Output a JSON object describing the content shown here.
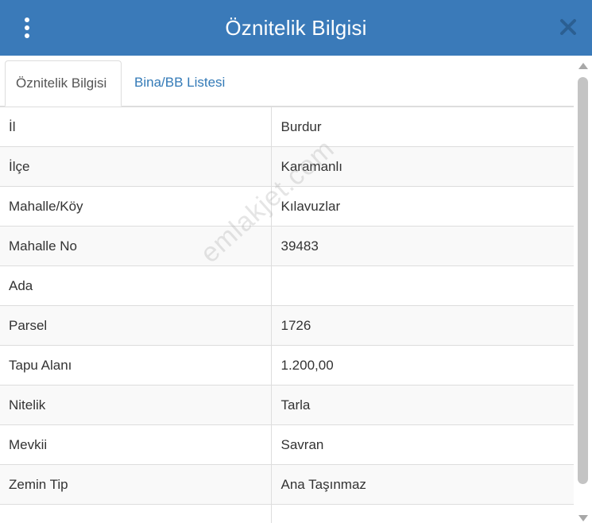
{
  "header": {
    "title": "Öznitelik Bilgisi"
  },
  "tabs": [
    {
      "label": "Öznitelik Bilgisi",
      "active": true
    },
    {
      "label": "Bina/BB Listesi",
      "active": false
    }
  ],
  "rows": [
    {
      "key": "İl",
      "value": "Burdur"
    },
    {
      "key": "İlçe",
      "value": "Karamanlı"
    },
    {
      "key": "Mahalle/Köy",
      "value": "Kılavuzlar"
    },
    {
      "key": "Mahalle No",
      "value": "39483"
    },
    {
      "key": "Ada",
      "value": ""
    },
    {
      "key": "Parsel",
      "value": "1726"
    },
    {
      "key": "Tapu Alanı",
      "value": "1.200,00"
    },
    {
      "key": "Nitelik",
      "value": "Tarla"
    },
    {
      "key": "Mevkii",
      "value": "Savran"
    },
    {
      "key": "Zemin Tip",
      "value": "Ana Taşınmaz"
    }
  ],
  "watermark": "emlakjet.com",
  "colors": {
    "header_bg": "#3a7ab9",
    "tab_link": "#337ab7",
    "close_icon": "#2b5f92"
  },
  "icons": {
    "menu": "kebab-menu-icon",
    "close": "close-icon"
  }
}
